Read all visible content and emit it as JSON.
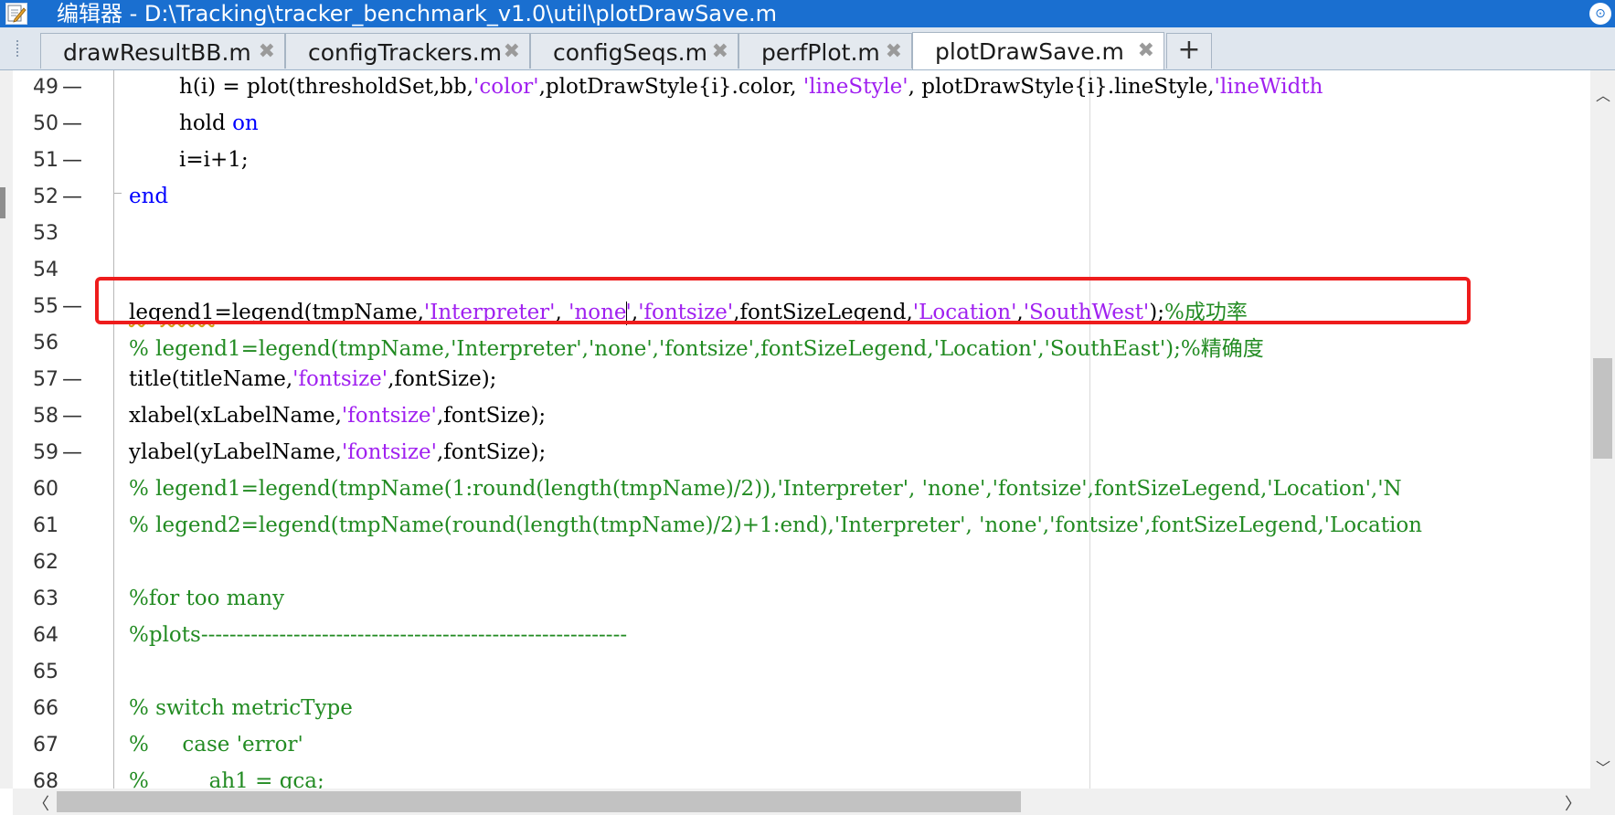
{
  "window": {
    "title": "编辑器 - D:\\Tracking\\tracker_benchmark_v1.0\\util\\plotDrawSave.m",
    "menu_glyph": "⊙"
  },
  "tabs": [
    {
      "label": "drawResultBB.m",
      "close": "✖"
    },
    {
      "label": "configTrackers.m",
      "close": "✖"
    },
    {
      "label": "configSeqs.m",
      "close": "✖"
    },
    {
      "label": "perfPlot.m",
      "close": "✖"
    },
    {
      "label": "plotDrawSave.m",
      "close": "✖",
      "active": true
    }
  ],
  "add_tab": "+",
  "lines": [
    {
      "num": "49",
      "dash": "—"
    },
    {
      "num": "50",
      "dash": "—"
    },
    {
      "num": "51",
      "dash": "—"
    },
    {
      "num": "52",
      "dash": "—"
    },
    {
      "num": "53",
      "dash": ""
    },
    {
      "num": "54",
      "dash": ""
    },
    {
      "num": "55",
      "dash": "—"
    },
    {
      "num": "56",
      "dash": ""
    },
    {
      "num": "57",
      "dash": "—"
    },
    {
      "num": "58",
      "dash": "—"
    },
    {
      "num": "59",
      "dash": "—"
    },
    {
      "num": "60",
      "dash": ""
    },
    {
      "num": "61",
      "dash": ""
    },
    {
      "num": "62",
      "dash": ""
    },
    {
      "num": "63",
      "dash": ""
    },
    {
      "num": "64",
      "dash": ""
    },
    {
      "num": "65",
      "dash": ""
    },
    {
      "num": "66",
      "dash": ""
    },
    {
      "num": "67",
      "dash": ""
    },
    {
      "num": "68",
      "dash": ""
    }
  ],
  "code": {
    "l49": {
      "a": "h(i) = plot(thresholdSet,bb,",
      "s1": "'color'",
      "b": ",plotDrawStyle{i}.color, ",
      "s2": "'lineStyle'",
      "c": ", plotDrawStyle{i}.lineStyle,",
      "s3": "'lineWidth"
    },
    "l50": {
      "a": "hold ",
      "kw": "on"
    },
    "l51": {
      "a": "i=i+1;"
    },
    "l52": {
      "kw": "end"
    },
    "l55": {
      "sq": "legend1",
      "a": "=legend(tmpName,",
      "s1": "'Interpreter'",
      "b": ", ",
      "s2a": "'none",
      "s2b": "'",
      "c": ",",
      "s3": "'fontsize'",
      "d": ",fontSizeLegend,",
      "s4": "'Location'",
      "e": ",",
      "s5": "'SouthWest'",
      "f": ");",
      "cm": "%成功率"
    },
    "l56": "% legend1=legend(tmpName,'Interpreter','none','fontsize',fontSizeLegend,'Location','SouthEast');%精确度",
    "l57": {
      "a": "title(titleName,",
      "s": "'fontsize'",
      "b": ",fontSize);"
    },
    "l58": {
      "a": "xlabel(xLabelName,",
      "s": "'fontsize'",
      "b": ",fontSize);"
    },
    "l59": {
      "a": "ylabel(yLabelName,",
      "s": "'fontsize'",
      "b": ",fontSize);"
    },
    "l60": "% legend1=legend(tmpName(1:round(length(tmpName)/2)),'Interpreter', 'none','fontsize',fontSizeLegend,'Location','N",
    "l61": "% legend2=legend(tmpName(round(length(tmpName)/2)+1:end),'Interpreter', 'none','fontsize',fontSizeLegend,'Location",
    "l63": "%for too many",
    "l64": "%plots------------------------------------------------------------",
    "l66": "% switch metricType",
    "l67": "%     case 'error'",
    "l68": "%         ah1 = gca;"
  },
  "scroll": {
    "up": "︿",
    "down": "﹀",
    "left": "〈",
    "right": "〉"
  },
  "colors": {
    "titlebar": "#1a6fd0",
    "keyword": "#0000ff",
    "string": "#a020f0",
    "comment": "#228b22",
    "highlight_box": "#ee1c1c"
  }
}
